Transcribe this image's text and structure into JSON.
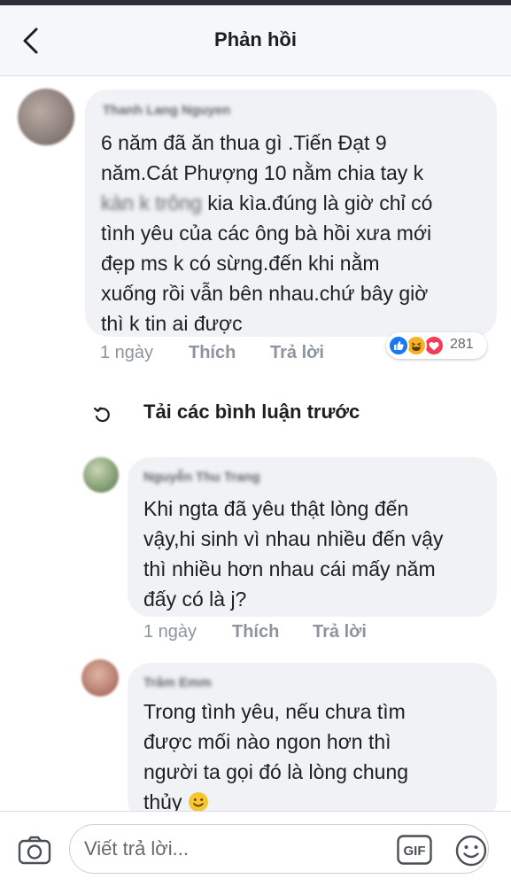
{
  "header": {
    "title": "Phản hồi"
  },
  "comments": [
    {
      "author": "Thanh Lang Nguyen",
      "lines": [
        "6 năm đã ăn thua gì .Tiến Đạt 9",
        "năm.Cát Phượng 10 nằm chia tay k",
        "kia kìa.đúng là giờ chỉ có",
        "tình yêu của các ông bà hồi xưa mới",
        "đẹp ms k có sừng.đến khi nằm",
        "xuống rồi vẫn bên nhau.chứ bây giờ",
        "thì k tin ai được"
      ],
      "blurred_fragment": "kàn k trông",
      "time": "1 ngày",
      "like_label": "Thích",
      "reply_label": "Trả lời",
      "reaction_count": "281"
    },
    {
      "author": "Nguyễn Thu Trang",
      "lines": [
        "Khi ngta đã yêu thật lòng đến",
        "vậy,hi sinh vì nhau nhiều đến vậy",
        "thì nhiều hơn nhau cái mấy năm",
        "đấy có là j?"
      ],
      "time": "1 ngày",
      "like_label": "Thích",
      "reply_label": "Trả lời"
    },
    {
      "author": "Trâm Emm",
      "lines": [
        "Trong tình yêu, nếu chưa tìm",
        "được mối nào ngon hơn thì",
        "người ta gọi đó là lòng chung",
        "thủy"
      ]
    }
  ],
  "load_previous": {
    "label": "Tải các bình luận trước"
  },
  "composer": {
    "placeholder": "Viết trả lời...",
    "gif_label": "GIF"
  },
  "colors": {
    "like": "#1877f2",
    "haha": "#f7b125",
    "love": "#f33e58",
    "bubble": "#f0f2f5"
  },
  "icons": [
    "back-arrow-icon",
    "refresh-icon",
    "like-reaction-icon",
    "haha-reaction-icon",
    "love-reaction-icon",
    "smile-emoji-icon",
    "camera-icon",
    "gif-icon",
    "emoji-icon"
  ]
}
